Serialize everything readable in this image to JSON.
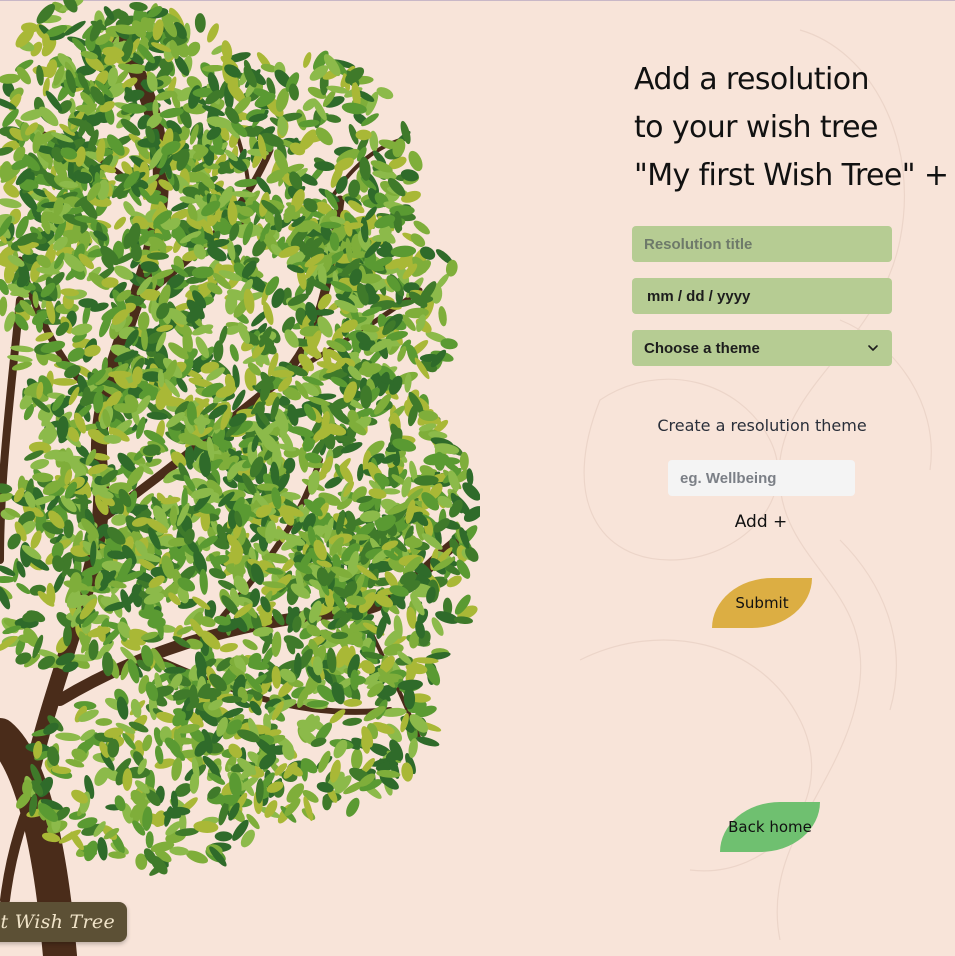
{
  "tree_banner": "My first Wish Tree",
  "heading": {
    "line1": "Add a resolution",
    "line2": "to your wish tree",
    "line3": "\"My first Wish Tree\" +"
  },
  "form": {
    "title_placeholder": "Resolution title",
    "date_placeholder": "mm / dd / yyyy",
    "theme_select": "Choose a theme",
    "create_theme_label": "Create a resolution theme",
    "new_theme_placeholder": "eg. Wellbeing",
    "add_button": "Add +",
    "submit_button": "Submit",
    "back_home_button": "Back home"
  },
  "colors": {
    "background": "#f8e4d9",
    "field": "#b6cc93",
    "submit": "#dcae43",
    "back_home": "#6fc070",
    "trunk": "#4a2c1a"
  }
}
